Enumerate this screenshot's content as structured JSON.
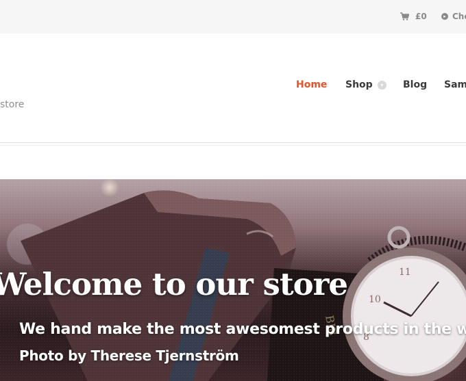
{
  "topbar": {
    "cart_total": "£0",
    "checkout_label": "Che"
  },
  "header": {
    "tagline": "store"
  },
  "nav": {
    "items": [
      {
        "label": "Home",
        "active": true
      },
      {
        "label": "Shop",
        "has_dropdown": true
      },
      {
        "label": "Blog"
      },
      {
        "label": "Samp"
      }
    ]
  },
  "hero": {
    "title": "Welcome to our store",
    "subtitle": "We hand make the most awesomest products in the worl",
    "credit": "Photo by Therese Tjernström"
  },
  "colors": {
    "accent": "#e2552b",
    "nav_text": "#3b3b3b",
    "topbar_bg": "#f6f6f6",
    "muted_text": "#8a8a8a"
  }
}
